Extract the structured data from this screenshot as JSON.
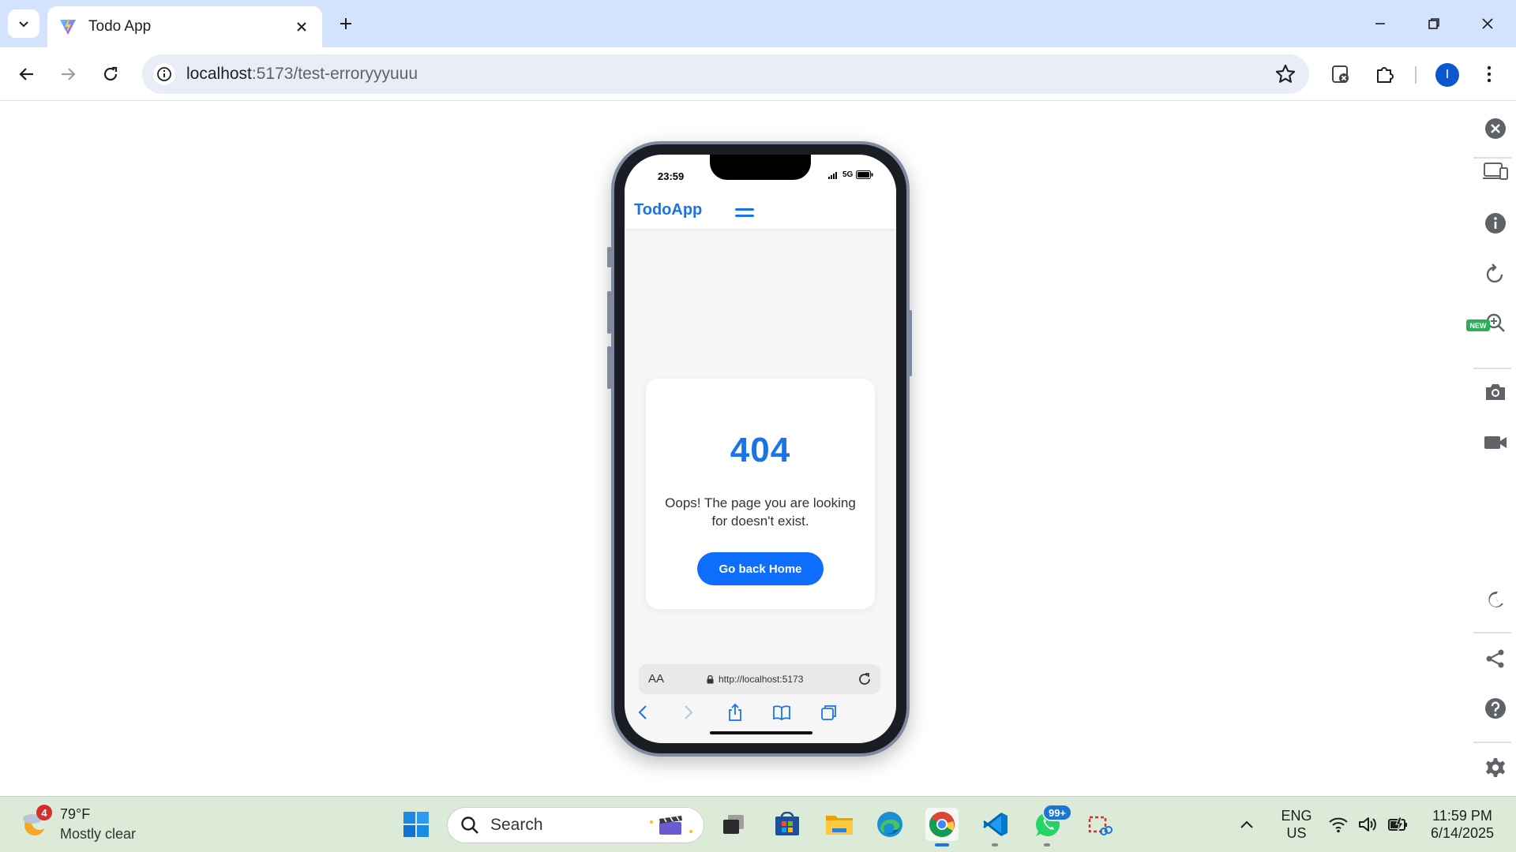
{
  "browser": {
    "tab_title": "Todo App",
    "url_host": "localhost",
    "url_path": ":5173/test-erroryyyuuu",
    "profile_initial": "I"
  },
  "app": {
    "status_time": "23:59",
    "network": "5G",
    "brand": "TodoApp",
    "error_code": "404",
    "error_message": "Oops! The page you are looking for doesn't exist.",
    "home_button": "Go back Home",
    "safari_aa": "AA",
    "safari_url": "http://localhost:5173"
  },
  "side_panel": {
    "new_badge": "NEW"
  },
  "taskbar": {
    "weather_badge": "4",
    "temperature": "79°F",
    "weather_desc": "Mostly clear",
    "search_label": "Search",
    "whatsapp_badge": "99+",
    "lang_top": "ENG",
    "lang_bottom": "US",
    "clock_time": "11:59 PM",
    "clock_date": "6/14/2025"
  },
  "colors": {
    "accent": "#1a73e8",
    "button": "#0d6efd",
    "tabstrip": "#d3e3fd",
    "taskbar": "#dcebd7"
  }
}
